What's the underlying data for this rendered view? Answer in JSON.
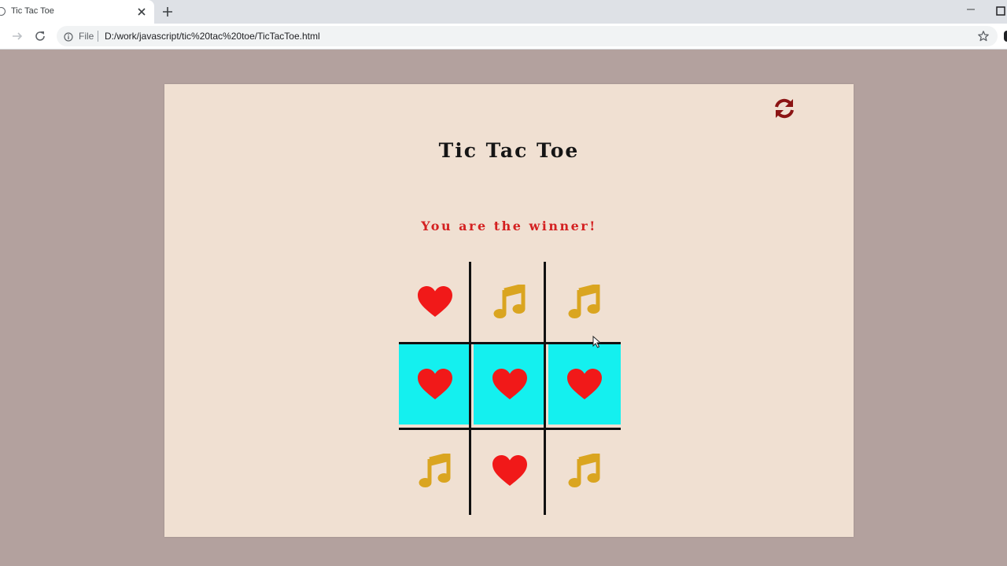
{
  "browser": {
    "tab_title": "Tic Tac Toe",
    "url_scheme": "File",
    "url": "D:/work/javascript/tic%20tac%20toe/TicTacToe.html",
    "icons": [
      "close-icon",
      "plus-icon",
      "minimize-icon",
      "maximize-icon",
      "forward-icon",
      "reload-icon",
      "info-icon",
      "star-icon"
    ]
  },
  "game": {
    "title": "Tic Tac Toe",
    "status": "You are the winner!",
    "reset_icon": "refresh-icon",
    "board": [
      [
        "heart",
        "note",
        "note"
      ],
      [
        "heart",
        "heart",
        "heart"
      ],
      [
        "note",
        "heart",
        "note"
      ]
    ],
    "winning_row": 1,
    "colors": {
      "heart": "#f11919",
      "note": "#daa520",
      "win_highlight": "#14f0ef",
      "status": "#d42121",
      "reset": "#8b1414",
      "card": "#f0e0d2",
      "background": "#b3a19e"
    }
  }
}
